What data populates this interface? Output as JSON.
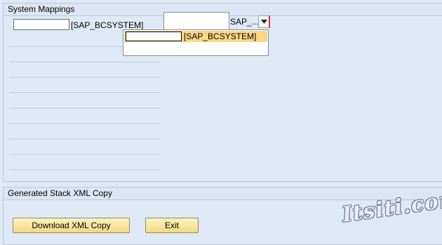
{
  "system_mappings": {
    "title": "System Mappings",
    "row_label": "[SAP_BCSYSTEM]",
    "combo_value": "SAP_...",
    "dropdown_option": "[SAP_BCSYSTEM]"
  },
  "stack_copy": {
    "title": "Generated Stack XML Copy",
    "download_label": "Download XML Copy",
    "exit_label": "Exit"
  },
  "watermark": "Itsiti.com",
  "icons": {
    "combo_toggle": "chevron-down-icon"
  },
  "colors": {
    "background": "#dfe9f5",
    "button": "#f6e3a0",
    "selected_option": "#fcd785"
  }
}
